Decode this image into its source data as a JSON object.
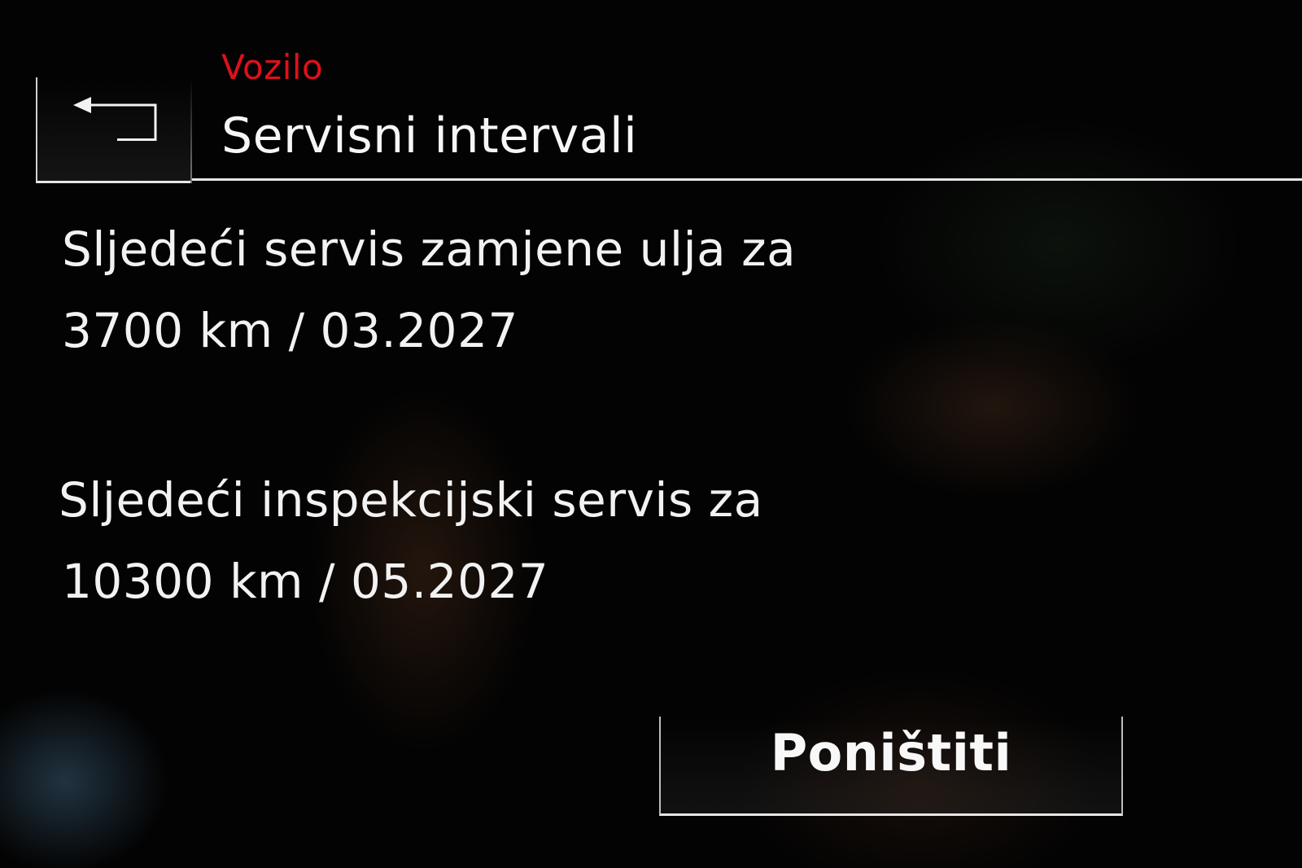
{
  "header": {
    "breadcrumb": "Vozilo",
    "title": "Servisni intervali",
    "back_icon": "back-arrow-icon",
    "accent_color": "#e0101b"
  },
  "service": {
    "oil_change": {
      "label": "Sljedeći servis zamjene ulja za",
      "value": "3700 km / 03.2027"
    },
    "inspection": {
      "label": "Sljedeći inspekcijski servis za",
      "value": "10300 km / 05.2027"
    }
  },
  "actions": {
    "reset_label": "Poništiti"
  }
}
